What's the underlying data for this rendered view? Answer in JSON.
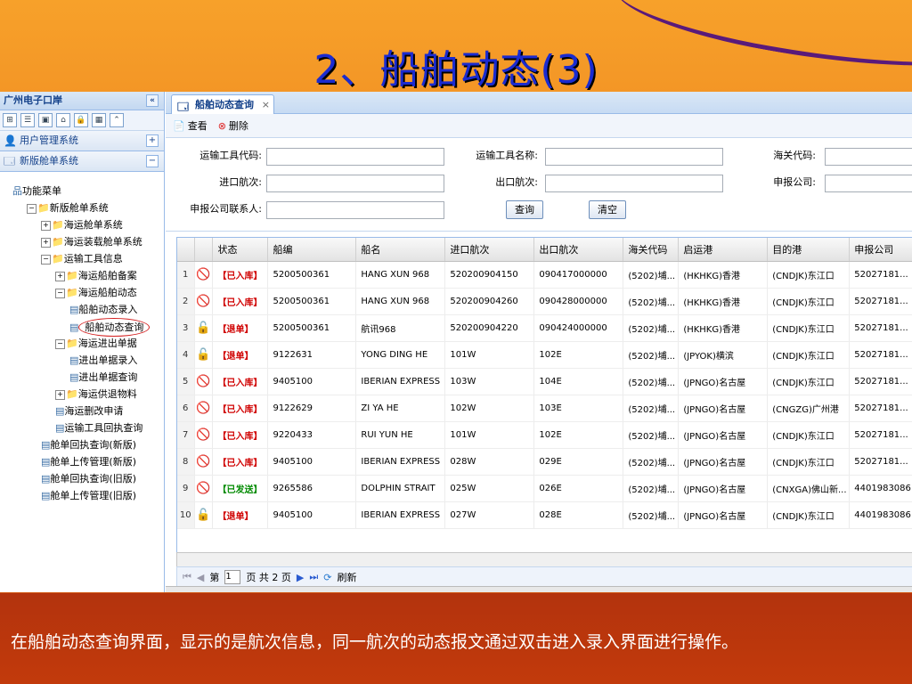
{
  "slide": {
    "title": "2、船舶动态(3)",
    "caption": "在船舶动态查询界面，显示的是航次信息，同一航次的动态报文通过双击进入录入界面进行操作。"
  },
  "sidebar": {
    "header": "广州电子口岸",
    "collapse": "«",
    "accordion": [
      {
        "label": "用户管理系统",
        "toggle": "+"
      },
      {
        "label": "新版舱单系统",
        "toggle": "−"
      }
    ],
    "tree": [
      {
        "label": "功能菜单",
        "level": 0,
        "type": "root"
      },
      {
        "label": "新版舱单系统",
        "level": 1,
        "type": "folder",
        "pm": "−"
      },
      {
        "label": "海运舱单系统",
        "level": 2,
        "type": "folder",
        "pm": "+"
      },
      {
        "label": "海运装载舱单系统",
        "level": 2,
        "type": "folder",
        "pm": "+"
      },
      {
        "label": "运输工具信息",
        "level": 2,
        "type": "folder",
        "pm": "−"
      },
      {
        "label": "海运船舶备案",
        "level": 3,
        "type": "folder",
        "pm": "+"
      },
      {
        "label": "海运船舶动态",
        "level": 3,
        "type": "folder",
        "pm": "−"
      },
      {
        "label": "船舶动态录入",
        "level": 4,
        "type": "doc"
      },
      {
        "label": "船舶动态查询",
        "level": 4,
        "type": "doc",
        "selected": true
      },
      {
        "label": "海运进出单据",
        "level": 3,
        "type": "folder",
        "pm": "−"
      },
      {
        "label": "进出单据录入",
        "level": 4,
        "type": "doc"
      },
      {
        "label": "进出单据查询",
        "level": 4,
        "type": "doc"
      },
      {
        "label": "海运供退物料",
        "level": 3,
        "type": "folder",
        "pm": "+"
      },
      {
        "label": "海运删改申请",
        "level": 3,
        "type": "doc"
      },
      {
        "label": "运输工具回执查询",
        "level": 3,
        "type": "doc"
      },
      {
        "label": "舱单回执查询(新版)",
        "level": 2,
        "type": "doc"
      },
      {
        "label": "舱单上传管理(新版)",
        "level": 2,
        "type": "doc"
      },
      {
        "label": "舱单回执查询(旧版)",
        "level": 2,
        "type": "doc"
      },
      {
        "label": "舱单上传管理(旧版)",
        "level": 2,
        "type": "doc"
      }
    ]
  },
  "tab": {
    "label": "船舶动态查询",
    "close": "×"
  },
  "toolbar": {
    "view": "查看",
    "delete": "删除"
  },
  "form": {
    "tool_code_label": "运输工具代码:",
    "tool_name_label": "运输工具名称:",
    "customs_code_label": "海关代码:",
    "in_voyage_label": "进口航次:",
    "out_voyage_label": "出口航次:",
    "declarer_label": "申报公司:",
    "contact_label": "申报公司联系人:",
    "query_button": "查询",
    "clear_button": "清空"
  },
  "grid": {
    "columns": [
      "状态",
      "船编",
      "船名",
      "进口航次",
      "出口航次",
      "海关代码",
      "启运港",
      "目的港",
      "申报公司"
    ],
    "rows": [
      {
        "n": "1",
        "icon": "ban",
        "status": "【已入库】",
        "color": "red",
        "ship": "5200500361",
        "name": "HANG XUN 968",
        "inv": "520200904150",
        "outv": "090417000000",
        "customs": "(5202)埔...",
        "from": "(HKHKG)香港",
        "to": "(CNDJK)东江口",
        "company": "52027181..."
      },
      {
        "n": "2",
        "icon": "ban",
        "status": "【已入库】",
        "color": "red",
        "ship": "5200500361",
        "name": "HANG XUN 968",
        "inv": "520200904260",
        "outv": "090428000000",
        "customs": "(5202)埔...",
        "from": "(HKHKG)香港",
        "to": "(CNDJK)东江口",
        "company": "52027181..."
      },
      {
        "n": "3",
        "icon": "lock",
        "status": "【退单】",
        "color": "red",
        "ship": "5200500361",
        "name": "航讯968",
        "inv": "520200904220",
        "outv": "090424000000",
        "customs": "(5202)埔...",
        "from": "(HKHKG)香港",
        "to": "(CNDJK)东江口",
        "company": "52027181..."
      },
      {
        "n": "4",
        "icon": "lock",
        "status": "【退单】",
        "color": "red",
        "ship": "9122631",
        "name": "YONG DING HE",
        "inv": "101W",
        "outv": "102E",
        "customs": "(5202)埔...",
        "from": "(JPYOK)横滨",
        "to": "(CNDJK)东江口",
        "company": "52027181..."
      },
      {
        "n": "5",
        "icon": "ban",
        "status": "【已入库】",
        "color": "red",
        "ship": "9405100",
        "name": "IBERIAN EXPRESS",
        "inv": "103W",
        "outv": "104E",
        "customs": "(5202)埔...",
        "from": "(JPNGO)名古屋",
        "to": "(CNDJK)东江口",
        "company": "52027181..."
      },
      {
        "n": "6",
        "icon": "ban",
        "status": "【已入库】",
        "color": "red",
        "ship": "9122629",
        "name": "ZI YA HE",
        "inv": "102W",
        "outv": "103E",
        "customs": "(5202)埔...",
        "from": "(JPNGO)名古屋",
        "to": "(CNGZG)广州港",
        "company": "52027181..."
      },
      {
        "n": "7",
        "icon": "ban",
        "status": "【已入库】",
        "color": "red",
        "ship": "9220433",
        "name": "RUI YUN HE",
        "inv": "101W",
        "outv": "102E",
        "customs": "(5202)埔...",
        "from": "(JPNGO)名古屋",
        "to": "(CNDJK)东江口",
        "company": "52027181..."
      },
      {
        "n": "8",
        "icon": "ban",
        "status": "【已入库】",
        "color": "red",
        "ship": "9405100",
        "name": "IBERIAN EXPRESS",
        "inv": "028W",
        "outv": "029E",
        "customs": "(5202)埔...",
        "from": "(JPNGO)名古屋",
        "to": "(CNDJK)东江口",
        "company": "52027181..."
      },
      {
        "n": "9",
        "icon": "ban",
        "status": "【已发送】",
        "color": "green",
        "ship": "9265586",
        "name": "DOLPHIN STRAIT",
        "inv": "025W",
        "outv": "026E",
        "customs": "(5202)埔...",
        "from": "(JPNGO)名古屋",
        "to": "(CNXGA)佛山新...",
        "company": "4401983086"
      },
      {
        "n": "10",
        "icon": "lock",
        "status": "【退单】",
        "color": "red",
        "ship": "9405100",
        "name": "IBERIAN EXPRESS",
        "inv": "027W",
        "outv": "028E",
        "customs": "(5202)埔...",
        "from": "(JPNGO)名古屋",
        "to": "(CNDJK)东江口",
        "company": "4401983086"
      }
    ]
  },
  "pager": {
    "page_prefix": "第",
    "page_value": "1",
    "page_suffix": "页 共 2 页",
    "refresh": "刷新"
  },
  "icons": {
    "ban": "🚫",
    "lock": "🔓"
  }
}
